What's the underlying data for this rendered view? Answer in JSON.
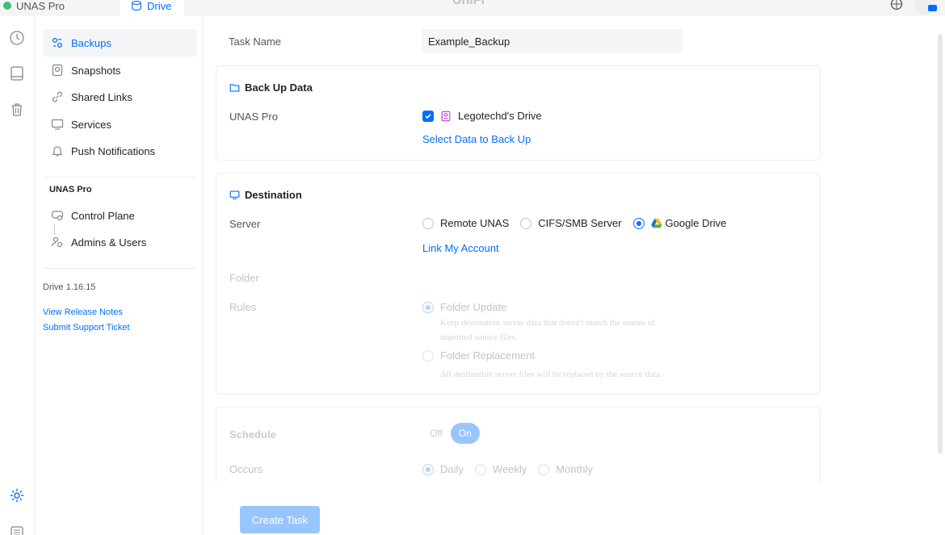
{
  "topbar": {
    "unas_tab": "UNAS Pro",
    "drive_tab": "Drive",
    "center_title": "UniFi"
  },
  "sidebar": {
    "items": [
      {
        "label": "Backups",
        "icon": "backup-icon",
        "active": true
      },
      {
        "label": "Snapshots",
        "icon": "snapshot-icon"
      },
      {
        "label": "Shared Links",
        "icon": "link-icon"
      },
      {
        "label": "Services",
        "icon": "monitor-icon"
      },
      {
        "label": "Push Notifications",
        "icon": "bell-icon"
      }
    ],
    "section_heading": "UNAS Pro",
    "section_items": [
      {
        "label": "Control Plane",
        "icon": "control-plane-icon"
      },
      {
        "label": "Admins & Users",
        "icon": "users-icon"
      }
    ],
    "version": "Drive 1.16.15",
    "release_notes": "View Release Notes",
    "support": "Submit Support Ticket"
  },
  "main": {
    "task_name_label": "Task Name",
    "task_name_value": "Example_Backup",
    "backup_card": {
      "title": "Back Up Data",
      "source_label": "UNAS Pro",
      "drive_name": "Legotechd's Drive",
      "select_link": "Select Data to Back Up"
    },
    "destination_card": {
      "title": "Destination",
      "server_label": "Server",
      "server_options": [
        "Remote UNAS",
        "CIFS/SMB Server",
        "Google Drive"
      ],
      "selected_server": "Google Drive",
      "link_account": "Link My Account",
      "folder_label": "Folder",
      "rules_label": "Rules",
      "rule_1": "Folder Update",
      "rule_1_help_line1": "Keep destination server data that doesn't match the names of",
      "rule_1_help_line2": "imported source files.",
      "rule_2": "Folder Replacement",
      "rule_2_help": "All destination server files will be replaced by the source data."
    },
    "schedule_card": {
      "schedule_label": "Schedule",
      "toggle_off": "Off",
      "toggle_on": "On",
      "occurs_label": "Occurs",
      "occurs_options": [
        "Daily",
        "Weekly",
        "Monthly"
      ]
    },
    "create_button": "Create Task"
  },
  "colors": {
    "accent": "#006fff",
    "accent_disabled": "#99c5ff",
    "text": "#212327",
    "muted": "#50565e"
  }
}
